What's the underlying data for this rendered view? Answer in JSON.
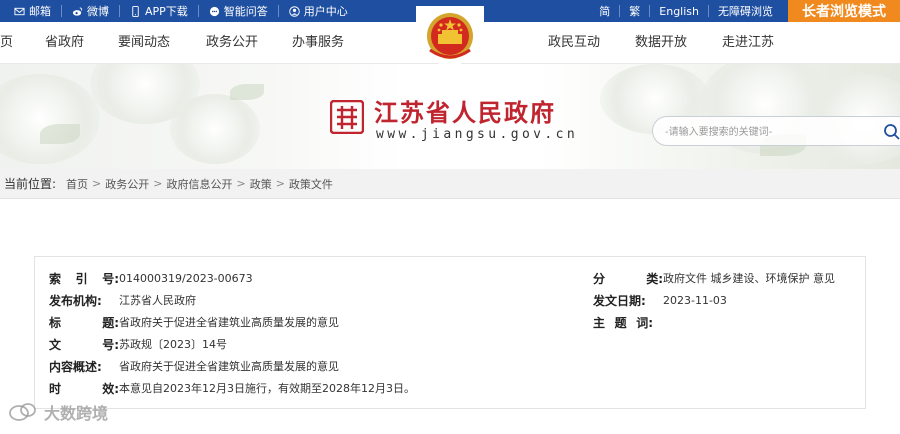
{
  "topbar": {
    "left_items": [
      {
        "label": "邮箱",
        "icon": "mail-icon"
      },
      {
        "label": "微博",
        "icon": "weibo-icon"
      },
      {
        "label": "APP下载",
        "icon": "phone-icon"
      },
      {
        "label": "智能问答",
        "icon": "chat-icon"
      },
      {
        "label": "用户中心",
        "icon": "user-icon"
      }
    ],
    "right_items": [
      "简",
      "繁",
      "English",
      "无障碍浏览"
    ],
    "elder_mode": "长者浏览模式"
  },
  "nav": {
    "items": [
      "页",
      "省政府",
      "要闻动态",
      "政务公开",
      "办事服务",
      "政民互动",
      "数据开放",
      "走进江苏"
    ]
  },
  "banner": {
    "site_title": "江苏省人民政府",
    "site_url": "www.jiangsu.gov.cn",
    "search_placeholder": "-请输入要搜索的关键词-"
  },
  "breadcrumb": {
    "label": "当前位置:",
    "items": [
      "首页",
      "政务公开",
      "政府信息公开",
      "政策",
      "政策文件"
    ]
  },
  "document": {
    "left": [
      {
        "key": [
          "索",
          "引",
          "号:"
        ],
        "value": "014000319/2023-00673"
      },
      {
        "key": [
          "发布机构:"
        ],
        "value": "江苏省人民政府"
      },
      {
        "key": [
          "标",
          "题:"
        ],
        "value": "省政府关于促进全省建筑业高质量发展的意见"
      },
      {
        "key": [
          "文",
          "号:"
        ],
        "value": "苏政规〔2023〕14号"
      },
      {
        "key": [
          "内容概述:"
        ],
        "value": "省政府关于促进全省建筑业高质量发展的意见"
      },
      {
        "key": [
          "时",
          "效:"
        ],
        "value": "本意见自2023年12月3日施行，有效期至2028年12月3日。"
      }
    ],
    "right": [
      {
        "key": [
          "分",
          "类:"
        ],
        "value": "政府文件 城乡建设、环境保护 意见"
      },
      {
        "key": [
          "发文日期:"
        ],
        "value": "2023-11-03"
      },
      {
        "key": [
          "主",
          "题",
          "词:"
        ],
        "value": ""
      }
    ]
  },
  "watermark": "大数跨境",
  "colors": {
    "topbar": "#1f4fa0",
    "elder_button": "#f08a1f",
    "site_title": "#c0242e"
  }
}
